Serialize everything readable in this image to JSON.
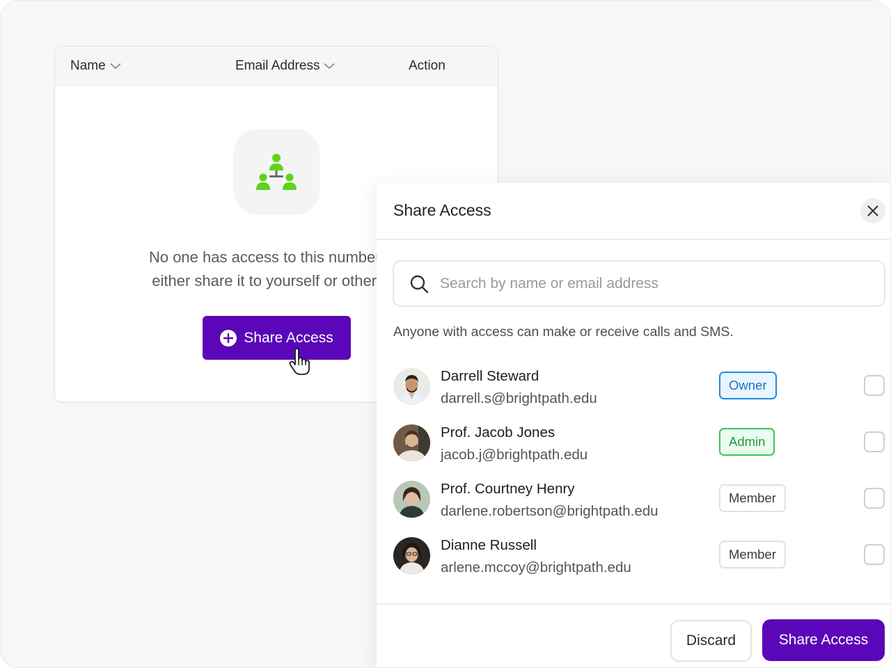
{
  "table": {
    "columns": [
      {
        "label": "Name",
        "icon": "chevron-down-icon"
      },
      {
        "label": "Email Address",
        "icon": "chevron-down-icon"
      },
      {
        "label": "Action"
      }
    ],
    "empty_state": {
      "icon": "team-hierarchy-icon",
      "line1": "No one has access to this number yet",
      "line2": "either share it to yourself or other me",
      "button_label": "Share Access",
      "button_icon": "plus-circle-icon"
    }
  },
  "panel": {
    "title": "Share Access",
    "close_icon": "close-icon",
    "search": {
      "placeholder": "Search by name or email address",
      "value": ""
    },
    "info": "Anyone with access can make or receive calls and SMS.",
    "users": [
      {
        "name": "Darrell Steward",
        "email": "darrell.s@brightpath.edu",
        "role": "Owner",
        "checked": false
      },
      {
        "name": "Prof. Jacob Jones",
        "email": "jacob.j@brightpath.edu",
        "role": "Admin",
        "checked": false
      },
      {
        "name": "Prof. Courtney Henry",
        "email": "darlene.robertson@brightpath.edu",
        "role": "Member",
        "checked": false
      },
      {
        "name": "Dianne Russell",
        "email": "arlene.mccoy@brightpath.edu",
        "role": "Member",
        "checked": false
      }
    ],
    "footer": {
      "discard_label": "Discard",
      "share_label": "Share Access"
    }
  },
  "colors": {
    "primary": "#5b06b8",
    "owner": "#1e8ce0",
    "admin": "#39c65a",
    "icon_green": "#5fd31c"
  }
}
